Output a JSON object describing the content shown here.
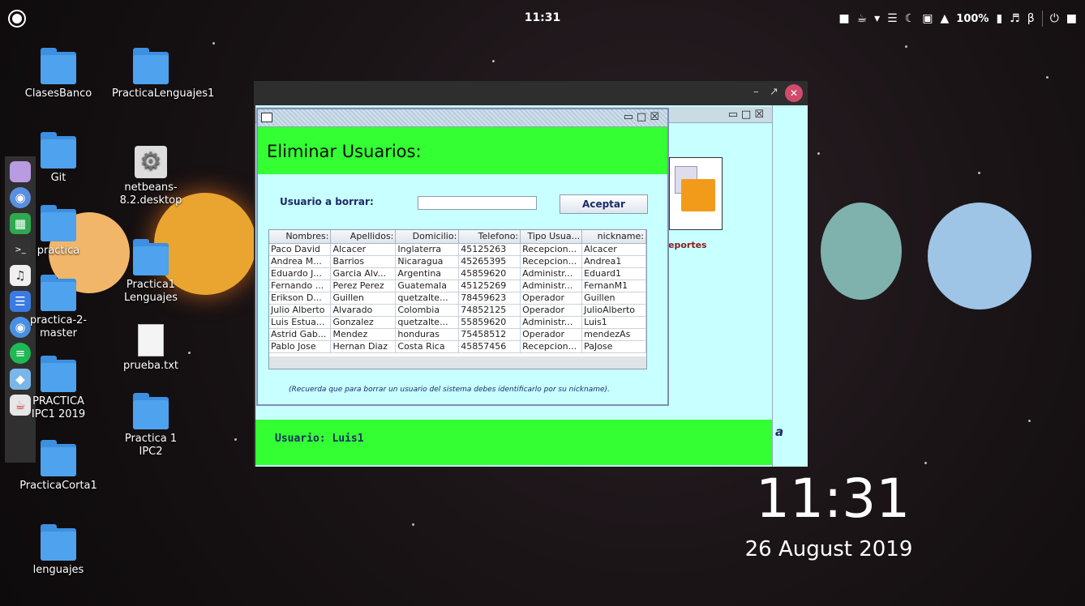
{
  "topbar": {
    "clock": "11:31",
    "tray": {
      "battery": "100%"
    }
  },
  "dock": {
    "items": [
      {
        "icon": "files-icon",
        "color": "#b99be1"
      },
      {
        "icon": "browser-icon",
        "color": "#5a8ee0"
      },
      {
        "icon": "spreadsheet-icon",
        "color": "#2fa84f"
      },
      {
        "icon": "terminal-icon",
        "color": "#333333"
      },
      {
        "icon": "music-icon",
        "color": "#f0f0f0"
      },
      {
        "icon": "document-icon",
        "color": "#3b7ae0"
      },
      {
        "icon": "chrome-icon",
        "color": "#4a90e2"
      },
      {
        "icon": "spotify-icon",
        "color": "#1db954"
      },
      {
        "icon": "package-icon",
        "color": "#7ab6e8"
      },
      {
        "icon": "java-icon",
        "color": "#e7e7e7"
      }
    ]
  },
  "desktop_icons": [
    {
      "label": "ClasesBanco",
      "type": "folder"
    },
    {
      "label": "PracticaLenguajes1",
      "type": "folder"
    },
    {
      "label": "Git",
      "type": "folder"
    },
    {
      "label": "netbeans-8.2.desktop",
      "type": "gear"
    },
    {
      "label": "practica",
      "type": "folder"
    },
    {
      "label": "Practica1 Lenguajes",
      "type": "folder"
    },
    {
      "label": "practica-2-master",
      "type": "folder"
    },
    {
      "label": "prueba.txt",
      "type": "text"
    },
    {
      "label": "PRACTICA IPC1 2019",
      "type": "folder"
    },
    {
      "label": "Practica 1 IPC2",
      "type": "folder"
    },
    {
      "label": "PracticaCorta1",
      "type": "folder"
    },
    {
      "label": "lenguajes",
      "type": "folder"
    }
  ],
  "desktop_clock": {
    "time": "11:31",
    "date": "26 August 2019"
  },
  "main_window": {
    "reportes_label": "eportes",
    "user_status": "Usuario: Luis1",
    "italic_letter": "a"
  },
  "delete_dialog": {
    "title": "Eliminar Usuarios:",
    "user_label": "Usuario a borrar:",
    "user_input_value": "",
    "accept_button": "Aceptar",
    "table": {
      "columns": [
        "Nombres:",
        "Apellidos:",
        "Domicilio:",
        "Telefono:",
        "Tipo Usua...",
        "nickname:"
      ],
      "rows": [
        [
          "Paco David",
          "Alcacer",
          "Inglaterra",
          "45125263",
          "Recepcion...",
          "Alcacer"
        ],
        [
          "Andrea M...",
          "Barrios",
          "Nicaragua",
          "45265395",
          "Recepcion...",
          "Andrea1"
        ],
        [
          "Eduardo J...",
          "Garcia Alv...",
          "Argentina",
          "45859620",
          "Administr...",
          "Eduard1"
        ],
        [
          "Fernando ...",
          "Perez Perez",
          "Guatemala",
          "45125269",
          "Administr...",
          "FernanM1"
        ],
        [
          "Erikson D...",
          "Guillen",
          "quetzalte...",
          "78459623",
          "Operador",
          "Guillen"
        ],
        [
          "Julio Alberto",
          "Alvarado",
          "Colombia",
          "74852125",
          "Operador",
          "JulioAlberto"
        ],
        [
          "Luis Estua...",
          "Gonzalez",
          "quetzalte...",
          "55859620",
          "Administr...",
          "Luis1"
        ],
        [
          "Astrid Gab...",
          "Mendez",
          "honduras",
          "75458512",
          "Operador",
          "mendezAs"
        ],
        [
          "Pablo Jose",
          "Hernan Diaz",
          "Costa Rica",
          "45857456",
          "Recepcion...",
          "PaJose"
        ]
      ]
    },
    "note": "(Recuerda que para borrar un usuario del sistema debes identificarlo por su nickname)."
  }
}
